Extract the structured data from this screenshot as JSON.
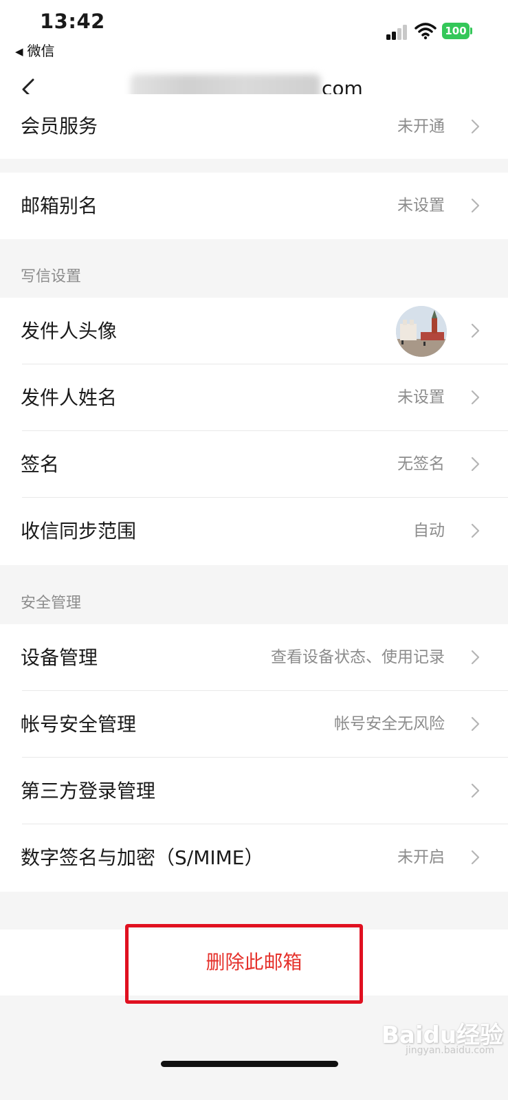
{
  "status_bar": {
    "time": "13:42",
    "back_app": "微信",
    "battery": "100"
  },
  "nav": {
    "title_suffix": "com",
    "back_icon": "chevron-left-icon"
  },
  "group_member": [
    {
      "label": "会员服务",
      "value": "未开通"
    }
  ],
  "group_alias": [
    {
      "label": "邮箱别名",
      "value": "未设置"
    }
  ],
  "compose_section": {
    "title": "写信设置",
    "rows": [
      {
        "label": "发件人头像",
        "value": ""
      },
      {
        "label": "发件人姓名",
        "value": "未设置"
      },
      {
        "label": "签名",
        "value": "无签名"
      },
      {
        "label": "收信同步范围",
        "value": "自动"
      }
    ]
  },
  "security_section": {
    "title": "安全管理",
    "rows": [
      {
        "label": "设备管理",
        "value": "查看设备状态、使用记录"
      },
      {
        "label": "帐号安全管理",
        "value": "帐号安全无风险"
      },
      {
        "label": "第三方登录管理",
        "value": ""
      },
      {
        "label": "数字签名与加密（S/MIME）",
        "value": "未开启"
      }
    ]
  },
  "delete_button": {
    "label": "删除此邮箱",
    "highlight_color": "#e01020",
    "text_color": "#e5322c"
  },
  "watermark": {
    "brand": "Baidu经验",
    "url": "jingyan.baidu.com"
  }
}
